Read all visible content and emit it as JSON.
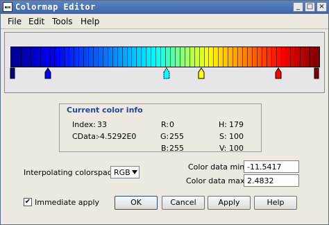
{
  "window": {
    "title": "Colormap Editor",
    "minimize_glyph": "_",
    "maximize_glyph": "□",
    "close_glyph": "×"
  },
  "menu": [
    "File",
    "Edit",
    "Tools",
    "Help"
  ],
  "colorbar": {
    "cell_count": 64,
    "markers": [
      {
        "color": "#00008f",
        "shape": "square",
        "selected": false
      },
      {
        "color": "#0000ff",
        "shape": "arrow",
        "selected": false
      },
      {
        "color": "#00ffff",
        "shape": "arrow",
        "selected": true
      },
      {
        "color": "#ffff00",
        "shape": "arrow",
        "selected": false
      },
      {
        "color": "#ff0000",
        "shape": "arrow",
        "selected": false
      },
      {
        "color": "#800000",
        "shape": "square",
        "selected": false
      }
    ]
  },
  "color_info": {
    "legend": "Current color info",
    "index_label": "Index:",
    "index_value": "33",
    "cdata_label": "CData:",
    "cdata_value": "-4.5292E0",
    "r_label": "R:",
    "r_value": "0",
    "g_label": "G:",
    "g_value": "255",
    "b_label": "B:",
    "b_value": "255",
    "h_label": "H:",
    "h_value": "179",
    "s_label": "S:",
    "s_value": "100",
    "v_label": "V:",
    "v_value": "100"
  },
  "interpolation": {
    "label": "Interpolating colorspace:",
    "value": "RGB"
  },
  "color_data": {
    "min_label": "Color data min:",
    "min_value": "-11.5417",
    "max_label": "Color data max:",
    "max_value": "2.4832"
  },
  "immediate_apply": {
    "label": "Immediate apply",
    "checked": true,
    "check_glyph": "✔"
  },
  "buttons": {
    "ok": "OK",
    "cancel": "Cancel",
    "apply": "Apply",
    "help": "Help"
  }
}
